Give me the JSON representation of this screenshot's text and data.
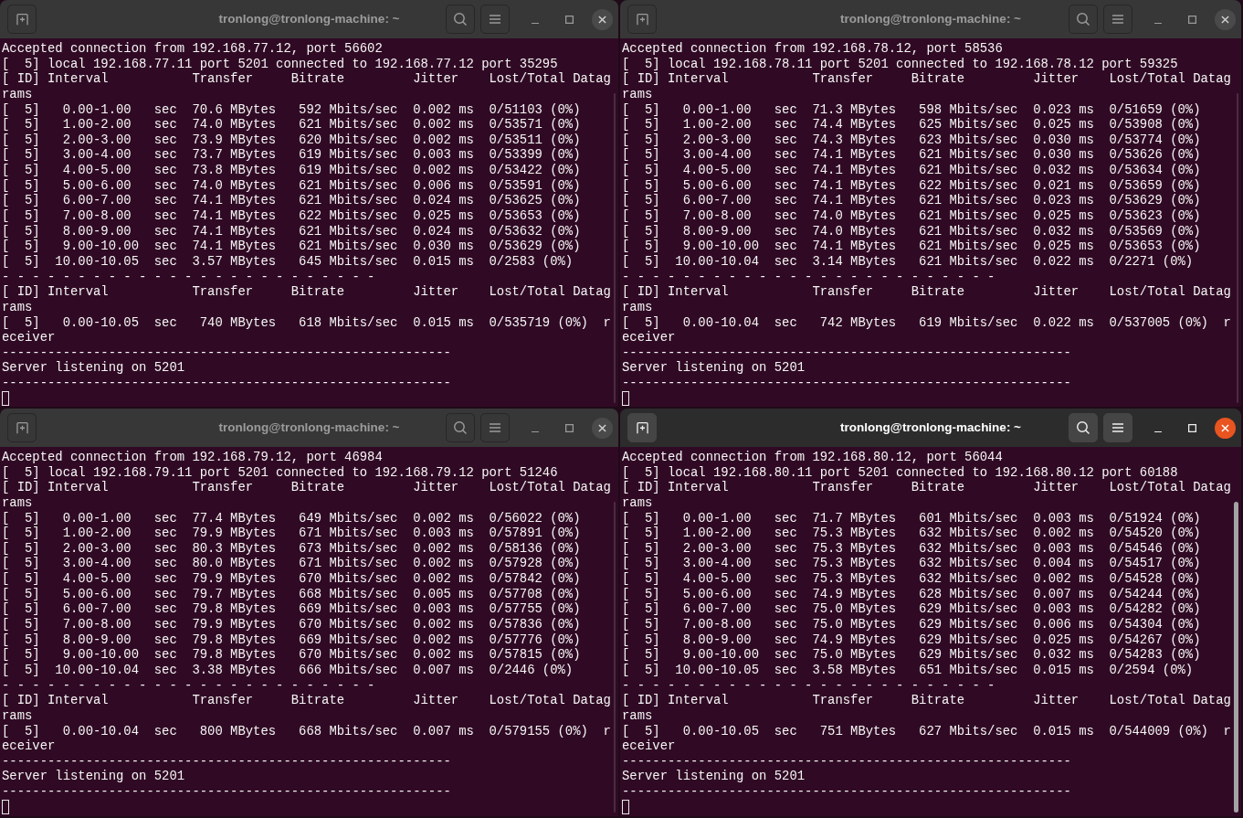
{
  "windows": [
    {
      "title": "tronlong@tronlong-machine: ~",
      "focused": false,
      "lines": [
        "Accepted connection from 192.168.77.12, port 56602",
        "[  5] local 192.168.77.11 port 5201 connected to 192.168.77.12 port 35295",
        "[ ID] Interval           Transfer     Bitrate         Jitter    Lost/Total Datag",
        "rams",
        "[  5]   0.00-1.00   sec  70.6 MBytes   592 Mbits/sec  0.002 ms  0/51103 (0%)",
        "[  5]   1.00-2.00   sec  74.0 MBytes   621 Mbits/sec  0.002 ms  0/53571 (0%)",
        "[  5]   2.00-3.00   sec  73.9 MBytes   620 Mbits/sec  0.002 ms  0/53511 (0%)",
        "[  5]   3.00-4.00   sec  73.7 MBytes   619 Mbits/sec  0.003 ms  0/53399 (0%)",
        "[  5]   4.00-5.00   sec  73.8 MBytes   619 Mbits/sec  0.002 ms  0/53422 (0%)",
        "[  5]   5.00-6.00   sec  74.0 MBytes   621 Mbits/sec  0.006 ms  0/53591 (0%)",
        "[  5]   6.00-7.00   sec  74.1 MBytes   621 Mbits/sec  0.024 ms  0/53625 (0%)",
        "[  5]   7.00-8.00   sec  74.1 MBytes   622 Mbits/sec  0.025 ms  0/53653 (0%)",
        "[  5]   8.00-9.00   sec  74.1 MBytes   621 Mbits/sec  0.024 ms  0/53632 (0%)",
        "[  5]   9.00-10.00  sec  74.1 MBytes   621 Mbits/sec  0.030 ms  0/53629 (0%)",
        "[  5]  10.00-10.05  sec  3.57 MBytes   645 Mbits/sec  0.015 ms  0/2583 (0%)",
        "- - - - - - - - - - - - - - - - - - - - - - - - -",
        "[ ID] Interval           Transfer     Bitrate         Jitter    Lost/Total Datag",
        "rams",
        "[  5]   0.00-10.05  sec   740 MBytes   618 Mbits/sec  0.015 ms  0/535719 (0%)  r",
        "eceiver",
        "-----------------------------------------------------------",
        "Server listening on 5201",
        "-----------------------------------------------------------"
      ]
    },
    {
      "title": "tronlong@tronlong-machine: ~",
      "focused": false,
      "lines": [
        "Accepted connection from 192.168.78.12, port 58536",
        "[  5] local 192.168.78.11 port 5201 connected to 192.168.78.12 port 59325",
        "[ ID] Interval           Transfer     Bitrate         Jitter    Lost/Total Datag",
        "rams",
        "[  5]   0.00-1.00   sec  71.3 MBytes   598 Mbits/sec  0.023 ms  0/51659 (0%)",
        "[  5]   1.00-2.00   sec  74.4 MBytes   625 Mbits/sec  0.025 ms  0/53908 (0%)",
        "[  5]   2.00-3.00   sec  74.3 MBytes   623 Mbits/sec  0.030 ms  0/53774 (0%)",
        "[  5]   3.00-4.00   sec  74.1 MBytes   621 Mbits/sec  0.030 ms  0/53626 (0%)",
        "[  5]   4.00-5.00   sec  74.1 MBytes   621 Mbits/sec  0.032 ms  0/53634 (0%)",
        "[  5]   5.00-6.00   sec  74.1 MBytes   622 Mbits/sec  0.021 ms  0/53659 (0%)",
        "[  5]   6.00-7.00   sec  74.1 MBytes   621 Mbits/sec  0.023 ms  0/53629 (0%)",
        "[  5]   7.00-8.00   sec  74.0 MBytes   621 Mbits/sec  0.025 ms  0/53623 (0%)",
        "[  5]   8.00-9.00   sec  74.0 MBytes   621 Mbits/sec  0.032 ms  0/53569 (0%)",
        "[  5]   9.00-10.00  sec  74.1 MBytes   621 Mbits/sec  0.025 ms  0/53653 (0%)",
        "[  5]  10.00-10.04  sec  3.14 MBytes   621 Mbits/sec  0.022 ms  0/2271 (0%)",
        "- - - - - - - - - - - - - - - - - - - - - - - - -",
        "[ ID] Interval           Transfer     Bitrate         Jitter    Lost/Total Datag",
        "rams",
        "[  5]   0.00-10.04  sec   742 MBytes   619 Mbits/sec  0.022 ms  0/537005 (0%)  r",
        "eceiver",
        "-----------------------------------------------------------",
        "Server listening on 5201",
        "-----------------------------------------------------------"
      ]
    },
    {
      "title": "tronlong@tronlong-machine: ~",
      "focused": false,
      "lines": [
        "Accepted connection from 192.168.79.12, port 46984",
        "[  5] local 192.168.79.11 port 5201 connected to 192.168.79.12 port 51246",
        "[ ID] Interval           Transfer     Bitrate         Jitter    Lost/Total Datag",
        "rams",
        "[  5]   0.00-1.00   sec  77.4 MBytes   649 Mbits/sec  0.002 ms  0/56022 (0%)",
        "[  5]   1.00-2.00   sec  79.9 MBytes   671 Mbits/sec  0.003 ms  0/57891 (0%)",
        "[  5]   2.00-3.00   sec  80.3 MBytes   673 Mbits/sec  0.002 ms  0/58136 (0%)",
        "[  5]   3.00-4.00   sec  80.0 MBytes   671 Mbits/sec  0.002 ms  0/57928 (0%)",
        "[  5]   4.00-5.00   sec  79.9 MBytes   670 Mbits/sec  0.002 ms  0/57842 (0%)",
        "[  5]   5.00-6.00   sec  79.7 MBytes   668 Mbits/sec  0.005 ms  0/57708 (0%)",
        "[  5]   6.00-7.00   sec  79.8 MBytes   669 Mbits/sec  0.003 ms  0/57755 (0%)",
        "[  5]   7.00-8.00   sec  79.9 MBytes   670 Mbits/sec  0.002 ms  0/57836 (0%)",
        "[  5]   8.00-9.00   sec  79.8 MBytes   669 Mbits/sec  0.002 ms  0/57776 (0%)",
        "[  5]   9.00-10.00  sec  79.8 MBytes   670 Mbits/sec  0.002 ms  0/57815 (0%)",
        "[  5]  10.00-10.04  sec  3.38 MBytes   666 Mbits/sec  0.007 ms  0/2446 (0%)",
        "- - - - - - - - - - - - - - - - - - - - - - - - -",
        "[ ID] Interval           Transfer     Bitrate         Jitter    Lost/Total Datag",
        "rams",
        "[  5]   0.00-10.04  sec   800 MBytes   668 Mbits/sec  0.007 ms  0/579155 (0%)  r",
        "eceiver",
        "-----------------------------------------------------------",
        "Server listening on 5201",
        "-----------------------------------------------------------"
      ]
    },
    {
      "title": "tronlong@tronlong-machine: ~",
      "focused": true,
      "lines": [
        "Accepted connection from 192.168.80.12, port 56044",
        "[  5] local 192.168.80.11 port 5201 connected to 192.168.80.12 port 60188",
        "[ ID] Interval           Transfer     Bitrate         Jitter    Lost/Total Datag",
        "rams",
        "[  5]   0.00-1.00   sec  71.7 MBytes   601 Mbits/sec  0.003 ms  0/51924 (0%)",
        "[  5]   1.00-2.00   sec  75.3 MBytes   632 Mbits/sec  0.002 ms  0/54520 (0%)",
        "[  5]   2.00-3.00   sec  75.3 MBytes   632 Mbits/sec  0.003 ms  0/54546 (0%)",
        "[  5]   3.00-4.00   sec  75.3 MBytes   632 Mbits/sec  0.004 ms  0/54517 (0%)",
        "[  5]   4.00-5.00   sec  75.3 MBytes   632 Mbits/sec  0.002 ms  0/54528 (0%)",
        "[  5]   5.00-6.00   sec  74.9 MBytes   628 Mbits/sec  0.007 ms  0/54244 (0%)",
        "[  5]   6.00-7.00   sec  75.0 MBytes   629 Mbits/sec  0.003 ms  0/54282 (0%)",
        "[  5]   7.00-8.00   sec  75.0 MBytes   629 Mbits/sec  0.006 ms  0/54304 (0%)",
        "[  5]   8.00-9.00   sec  74.9 MBytes   629 Mbits/sec  0.025 ms  0/54267 (0%)",
        "[  5]   9.00-10.00  sec  75.0 MBytes   629 Mbits/sec  0.032 ms  0/54283 (0%)",
        "[  5]  10.00-10.05  sec  3.58 MBytes   651 Mbits/sec  0.015 ms  0/2594 (0%)",
        "- - - - - - - - - - - - - - - - - - - - - - - - -",
        "[ ID] Interval           Transfer     Bitrate         Jitter    Lost/Total Datag",
        "rams",
        "[  5]   0.00-10.05  sec   751 MBytes   627 Mbits/sec  0.015 ms  0/544009 (0%)  r",
        "eceiver",
        "-----------------------------------------------------------",
        "Server listening on 5201",
        "-----------------------------------------------------------"
      ]
    }
  ]
}
